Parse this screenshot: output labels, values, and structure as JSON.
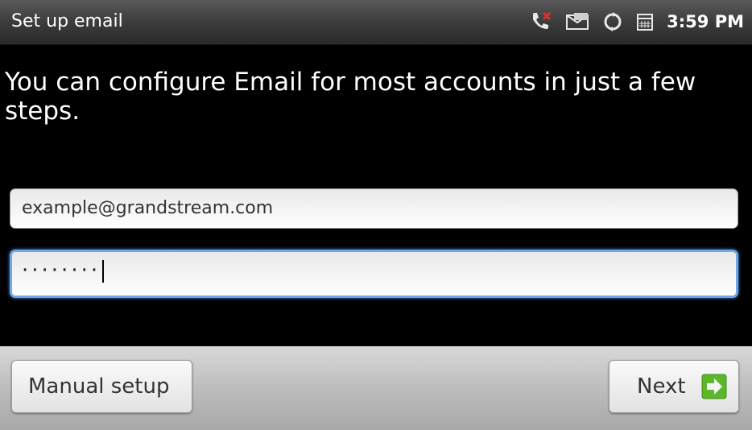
{
  "app": {
    "title": "Set up email"
  },
  "status_bar": {
    "time": "3:59 PM",
    "icons": [
      "missed-call-icon",
      "voicemail-icon",
      "sync-icon",
      "calendar-icon"
    ]
  },
  "main": {
    "intro_text": "You can configure Email for most accounts in just a few steps.",
    "email_field": {
      "value": "example@grandstream.com"
    },
    "password_field": {
      "masked_value": "········"
    }
  },
  "buttons": {
    "manual_setup_label": "Manual setup",
    "next_label": "Next"
  },
  "colors": {
    "focus_border": "#6fa6e8",
    "next_arrow_green": "#5cb82a"
  }
}
